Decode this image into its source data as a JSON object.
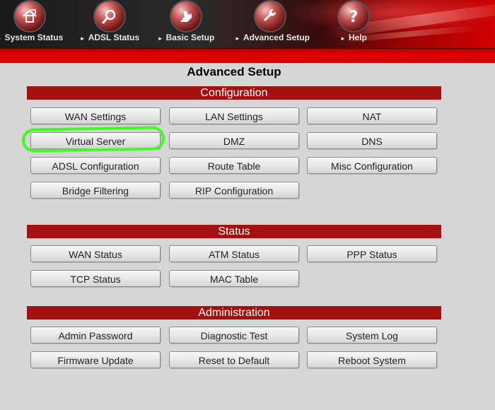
{
  "nav": {
    "items": [
      {
        "label": "System Status",
        "icon": "house-document-icon"
      },
      {
        "label": "ADSL Status",
        "icon": "magnifier-icon"
      },
      {
        "label": "Basic Setup",
        "icon": "hand-pointer-icon"
      },
      {
        "label": "Advanced Setup",
        "icon": "wrench-icon"
      },
      {
        "label": "Help",
        "icon": "question-mark-icon"
      }
    ],
    "accent_color": "#d00000"
  },
  "page": {
    "title": "Advanced Setup"
  },
  "sections": {
    "configuration": {
      "title": "Configuration",
      "buttons": [
        "WAN Settings",
        "LAN Settings",
        "NAT",
        "Virtual Server",
        "DMZ",
        "DNS",
        "ADSL Configuration",
        "Route Table",
        "Misc Configuration",
        "Bridge Filtering",
        "RIP Configuration"
      ]
    },
    "status": {
      "title": "Status",
      "buttons": [
        "WAN Status",
        "ATM Status",
        "PPP Status",
        "TCP Status",
        "MAC Table"
      ]
    },
    "administration": {
      "title": "Administration",
      "buttons": [
        "Admin Password",
        "Diagnostic Test",
        "System Log",
        "Firmware Update",
        "Reset to Default",
        "Reboot System"
      ]
    }
  },
  "colors": {
    "section_bar": "#a40f0f",
    "highlight_ring": "#3dff1f"
  }
}
